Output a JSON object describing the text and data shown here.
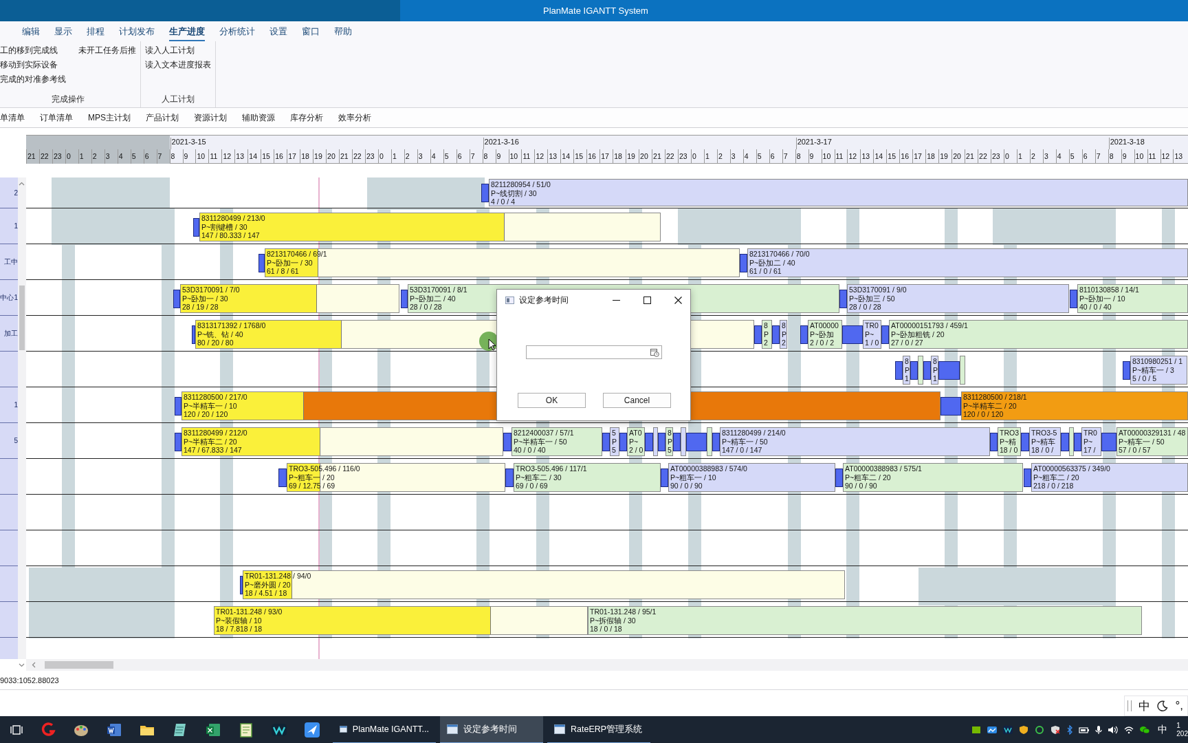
{
  "window": {
    "title": "PlanMate IGANTT System"
  },
  "menu": [
    {
      "label": "编辑",
      "selected": false
    },
    {
      "label": "显示",
      "selected": false
    },
    {
      "label": "排程",
      "selected": false
    },
    {
      "label": "计划发布",
      "selected": false
    },
    {
      "label": "生产进度",
      "selected": true
    },
    {
      "label": "分析统计",
      "selected": false
    },
    {
      "label": "设置",
      "selected": false
    },
    {
      "label": "窗口",
      "selected": false
    },
    {
      "label": "帮助",
      "selected": false
    }
  ],
  "ribbon": [
    {
      "label": "完成操作",
      "columns": [
        [
          "工的移到完成线",
          "移动到实际设备",
          "完成的对准参考线"
        ],
        [
          "未开工任务后推"
        ]
      ]
    },
    {
      "label": "人工计划",
      "columns": [
        [
          "读入人工计划",
          "读入文本进度报表"
        ]
      ]
    }
  ],
  "view_tabs": [
    "单清单",
    "订单清单",
    "MPS主计划",
    "产品计划",
    "资源计划",
    "辅助资源",
    "库存分析",
    "效率分析"
  ],
  "timeline": {
    "dates": [
      "2021-3-15",
      "2021-3-16",
      "2021-3-17",
      "2021-3-18"
    ],
    "hours": [
      "21",
      "22",
      "23",
      "0",
      "1",
      "2",
      "3",
      "4",
      "5",
      "6",
      "7",
      "8",
      "9",
      "10",
      "11",
      "12",
      "13",
      "14",
      "15",
      "16",
      "17",
      "18",
      "19",
      "20",
      "21",
      "22",
      "23",
      "0",
      "1",
      "2",
      "3",
      "4",
      "5",
      "6",
      "7",
      "8",
      "9",
      "10",
      "11",
      "12",
      "13",
      "14",
      "15",
      "16",
      "17",
      "18",
      "19",
      "20",
      "21",
      "22",
      "23",
      "0",
      "1",
      "2",
      "3",
      "4",
      "5",
      "6",
      "7",
      "8",
      "9",
      "10",
      "11",
      "12",
      "13",
      "14",
      "15",
      "16",
      "17",
      "18",
      "19",
      "20",
      "21",
      "22",
      "23",
      "0",
      "1",
      "2",
      "3",
      "4",
      "5",
      "6",
      "7",
      "8",
      "9",
      "10",
      "11",
      "12",
      "13"
    ]
  },
  "rows": [
    {
      "label": "2",
      "bars": [
        {
          "kind": "planned",
          "lines": [
            "8211280954 / 51/0",
            "P~线切割 / 30",
            "4 / 0 / 4"
          ]
        }
      ]
    },
    {
      "label": "1",
      "bars": [
        {
          "kind": "started",
          "level": 0.66,
          "lines": [
            "8311280499 / 213/0",
            "P~割键槽 / 30",
            "147 / 80.333 / 147"
          ]
        }
      ]
    },
    {
      "label": "工中",
      "bars": [
        {
          "kind": "started",
          "level": 0.11,
          "lines": [
            "8213170466 / 69/1",
            "P~卧加一 / 30",
            "61 / 8 / 61"
          ]
        },
        {
          "kind": "planned",
          "lines": [
            "8213170466 / 70/0",
            "P~卧加二 / 40",
            "61 / 0 / 61"
          ]
        }
      ]
    },
    {
      "label": "中心1",
      "bars": [
        {
          "kind": "started",
          "level": 0.62,
          "lines": [
            "53D3170091 / 7/0",
            "P~卧加一 / 30",
            "28 / 19 / 28"
          ]
        },
        {
          "kind": "released",
          "lines": [
            "53D3170091 / 8/1",
            "P~卧加二 / 40",
            "28 / 0 / 28"
          ]
        },
        {
          "kind": "planned",
          "lines": [
            "53D3170091 / 9/0",
            "P~卧加三 / 50",
            "28 / 0 / 28"
          ]
        },
        {
          "kind": "released",
          "lines": [
            "8110130858 / 14/1",
            "P~卧加一 / 10",
            "40 / 0 / 40"
          ]
        }
      ]
    },
    {
      "label": "加工",
      "bars": [
        {
          "kind": "started",
          "level": 0.26,
          "lines": [
            "8313171392 / 1768/0",
            "P~铣、钻 / 40",
            "80 / 20 / 80"
          ]
        },
        {
          "kind": "released",
          "lines": [
            "8",
            "P",
            "2"
          ]
        },
        {
          "kind": "planned",
          "lines": [
            "8",
            "P",
            "2"
          ]
        },
        {
          "kind": "released",
          "lines": [
            "AT00000",
            "P~卧加",
            "2 / 0 / 2"
          ]
        },
        {
          "kind": "planned",
          "lines": [
            "TR0",
            "P~",
            "1 / 0"
          ]
        },
        {
          "kind": "released",
          "lines": [
            "AT00000151793 / 459/1",
            "P~卧加粗铣 / 20",
            "27 / 0 / 27"
          ]
        }
      ]
    },
    {
      "bars": [
        {
          "kind": "planned",
          "lines": [
            "8",
            "P",
            "1"
          ]
        },
        {
          "kind": "released"
        },
        {
          "kind": "planned",
          "lines": [
            "8",
            "P",
            "1"
          ]
        },
        {
          "kind": "released"
        },
        {
          "kind": "planned",
          "lines": [
            "8310980251 / 1",
            "P~精车一 / 3",
            "5 / 0 / 5"
          ]
        }
      ]
    },
    {
      "label": "1",
      "bars": [
        {
          "kind": "overdue",
          "level": 0.16,
          "lines": [
            "8311280500 / 217/0",
            "P~半精车一 / 10",
            "120 / 20 / 120"
          ]
        },
        {
          "kind": "urgent",
          "lines": [
            "8311280500 / 218/1",
            "P~半精车二 / 20",
            "120 / 0 / 120"
          ]
        }
      ]
    },
    {
      "label": "5",
      "bars": [
        {
          "kind": "started",
          "level": 0.43,
          "lines": [
            "8311280499 / 212/0",
            "P~半精车二 / 20",
            "147 / 67.833 / 147"
          ]
        },
        {
          "kind": "released",
          "lines": [
            "8212400037 / 57/1",
            "P~半精车一 / 50",
            "40 / 0 / 40"
          ]
        },
        {
          "kind": "planned",
          "lines": [
            "5",
            "P",
            "5"
          ]
        },
        {
          "kind": "released",
          "lines": [
            "AT0",
            "P~",
            "2 / 0"
          ]
        },
        {
          "kind": "planned"
        },
        {
          "kind": "released",
          "lines": [
            "8",
            "P",
            "5"
          ]
        },
        {
          "kind": "planned"
        },
        {
          "kind": "released"
        },
        {
          "kind": "planned",
          "lines": [
            "8311280499 / 214/0",
            "P~精车一 / 50",
            "147 / 0 / 147"
          ]
        },
        {
          "kind": "released",
          "lines": [
            "TRO3",
            "P~精",
            "18 / 0"
          ]
        },
        {
          "kind": "planned",
          "lines": [
            "TRO3-5",
            "P~精车",
            "18 / 0 /"
          ]
        },
        {
          "kind": "released"
        },
        {
          "kind": "planned",
          "lines": [
            "TR0",
            "P~",
            "17 /"
          ]
        },
        {
          "kind": "released",
          "lines": [
            "AT00000329131 / 48",
            "P~精车一 / 50",
            "57 / 0 / 57"
          ]
        }
      ]
    },
    {
      "bars": [
        {
          "kind": "started",
          "level": 0.15,
          "lines": [
            "TRO3-505.496 / 116/0",
            "P~粗车一 / 20",
            "69 / 12.75 / 69"
          ]
        },
        {
          "kind": "released",
          "lines": [
            "TRO3-505.496 / 117/1",
            "P~粗车二 / 30",
            "69 / 0 / 69"
          ]
        },
        {
          "kind": "planned",
          "lines": [
            "AT00000388983 / 574/0",
            "P~粗车一 / 10",
            "90 / 0 / 90"
          ]
        },
        {
          "kind": "released",
          "lines": [
            "AT00000388983 / 575/1",
            "P~粗车二 / 20",
            "90 / 0 / 90"
          ]
        },
        {
          "kind": "planned",
          "lines": [
            "AT00000563375 / 349/0",
            "P~粗车二 / 20",
            "218 / 0 / 218"
          ]
        }
      ]
    },
    {},
    {},
    {
      "bars": [
        {
          "kind": "started",
          "level": 0.08,
          "lines": [
            "TR01-131.248 / 94/0",
            "P~磨外圆 / 20",
            "18 / 4.51 / 18"
          ]
        }
      ]
    },
    {
      "bars": [
        {
          "kind": "started",
          "level": 0.74,
          "lines": [
            "TR01-131.248 / 93/0",
            "P~装假轴 / 10",
            "18 / 7.818 / 18"
          ]
        },
        {
          "kind": "released",
          "lines": [
            "TR01-131.248 / 95/1",
            "P~拆假轴 / 30",
            "18 / 0 / 18"
          ]
        }
      ]
    }
  ],
  "status_bar": "9033:1052.88023",
  "dialog": {
    "title": "设定参考时间",
    "buttons": [
      "OK",
      "Cancel"
    ]
  },
  "ime_bar": {
    "mode": "中",
    "punctuation": "°,"
  },
  "taskbar": {
    "apps": [
      {
        "label": "PlanMate IGANTT...",
        "selected": false
      },
      {
        "label": "设定参考时间",
        "selected": true
      },
      {
        "label": "RateERP管理系统",
        "selected": false
      }
    ],
    "input_mode": "中",
    "clock_time": "1",
    "clock_date": "202"
  }
}
